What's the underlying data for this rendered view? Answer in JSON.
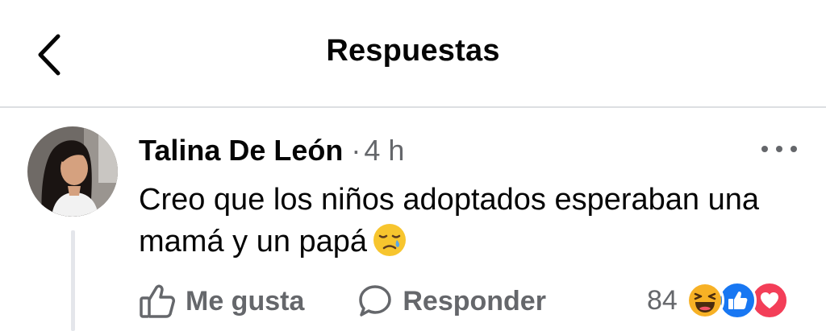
{
  "header": {
    "title": "Respuestas",
    "back_icon": "chevron-left-icon"
  },
  "comment": {
    "author": "Talina De León",
    "separator": "·",
    "timestamp": "4 h",
    "text": "Creo que los niños adoptados esperaban una mamá y un papá",
    "emoji": "crying-face-emoji",
    "more_icon": "more-horizontal-icon"
  },
  "actions": {
    "like_label": "Me gusta",
    "reply_label": "Responder"
  },
  "reactions": {
    "count": "84",
    "icons": [
      "haha-icon",
      "like-icon",
      "love-icon"
    ]
  },
  "colors": {
    "text_primary": "#050505",
    "text_secondary": "#65676b",
    "divider": "#dddfe2",
    "like_blue": "#1877f2",
    "love_red": "#f33e58",
    "haha_yellow": "#f7b125"
  }
}
